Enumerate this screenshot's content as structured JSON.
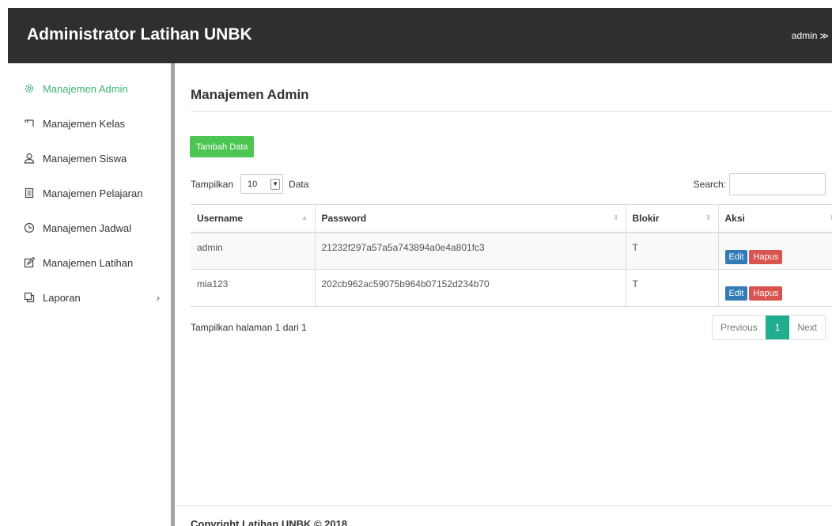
{
  "app": {
    "title": "Administrator Latihan UNBK",
    "user": "admin",
    "user_chevron": "≫"
  },
  "sidebar": {
    "items": [
      {
        "label": "Manajemen Admin",
        "icon": "gear-icon",
        "active": true
      },
      {
        "label": "Manajemen Kelas",
        "icon": "board-icon"
      },
      {
        "label": "Manajemen Siswa",
        "icon": "user-icon"
      },
      {
        "label": "Manajemen Pelajaran",
        "icon": "book-icon"
      },
      {
        "label": "Manajemen Jadwal",
        "icon": "clock-icon"
      },
      {
        "label": "Manajemen Latihan",
        "icon": "edit-icon"
      },
      {
        "label": "Laporan",
        "icon": "window-icon",
        "chevron": "›"
      }
    ]
  },
  "main": {
    "title": "Manajemen Admin",
    "add_button": "Tambah Data",
    "length": {
      "prefix": "Tampilkan",
      "value": "10",
      "suffix": "Data"
    },
    "search_label": "Search:",
    "table": {
      "headers": [
        "Username",
        "Password",
        "Blokir",
        "Aksi"
      ],
      "rows": [
        {
          "username": "admin",
          "password": "21232f297a57a5a743894a0e4a801fc3",
          "blokir": "T",
          "edit": "Edit",
          "delete": "Hapus"
        },
        {
          "username": "mia123",
          "password": "202cb962ac59075b964b07152d234b70",
          "blokir": "T",
          "edit": "Edit",
          "delete": "Hapus"
        }
      ]
    },
    "info": "Tampilkan halaman 1 dari 1",
    "pagination": {
      "previous": "Previous",
      "current": "1",
      "next": "Next"
    },
    "footer": "Copyright Latihan UNBK © 2018"
  },
  "colors": {
    "navbar": "#2f2f2f",
    "active": "#3cb371",
    "add_button": "#4cc552",
    "edit": "#337ab7",
    "delete": "#d9534f",
    "page_current": "#1fae8e"
  }
}
